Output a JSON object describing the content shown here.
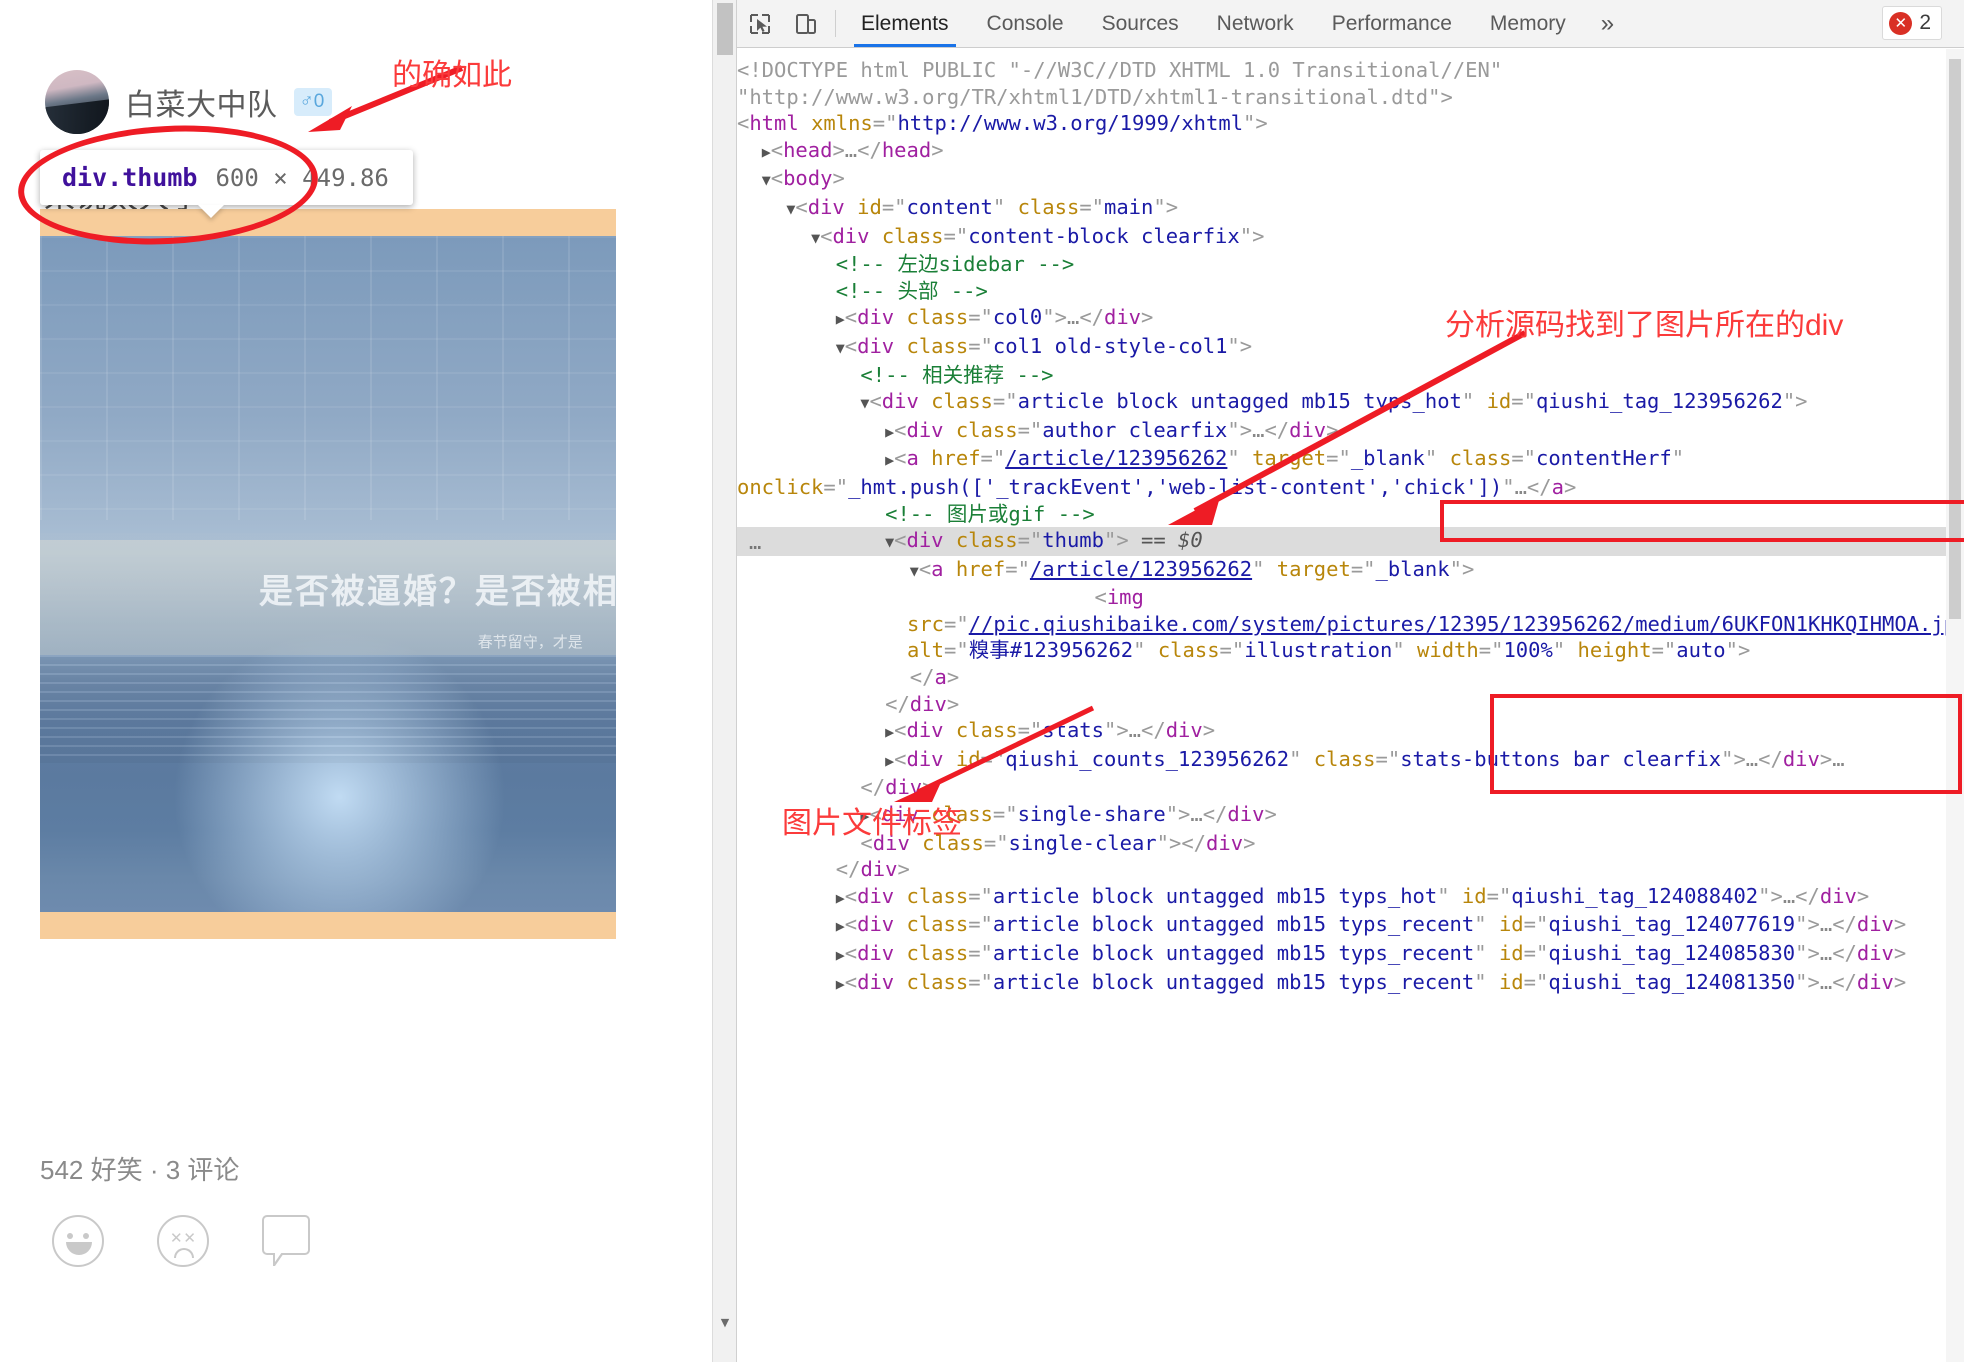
{
  "page": {
    "author_name": "白菜大中队",
    "gender_badge": "♂0",
    "text_behind_tooltip": "来说太大了",
    "banner_text": "是否被逼婚？是否被相亲",
    "banner_sub": "春节留守，才是",
    "stats": "542 好笑 · 3 评论",
    "reactions": [
      "smile-icon",
      "frown-icon",
      "comment-icon"
    ]
  },
  "tooltip": {
    "selector": "div.thumb",
    "dimensions": "600 × 449.86"
  },
  "annotations": [
    {
      "name": "confirm-note",
      "text": "的确如此"
    },
    {
      "name": "found-div-note",
      "text": "分析源码找到了图片所在的div"
    },
    {
      "name": "img-tag-note",
      "text": "图片文件标签"
    }
  ],
  "devtools": {
    "icons": [
      "inspect-element-icon",
      "device-toolbar-icon"
    ],
    "tabs": [
      {
        "label": "Elements",
        "active": true
      },
      {
        "label": "Console",
        "active": false
      },
      {
        "label": "Sources",
        "active": false
      },
      {
        "label": "Network",
        "active": false
      },
      {
        "label": "Performance",
        "active": false
      },
      {
        "label": "Memory",
        "active": false
      }
    ],
    "more_tabs": "»",
    "error_count": "2",
    "error_icon": "✕",
    "accent_color": "#1a73e8",
    "error_color": "#d93025",
    "dom_lines": [
      {
        "indent": 0,
        "type": "doctype",
        "text": "<!DOCTYPE html PUBLIC \"-//W3C//DTD XHTML 1.0 Transitional//EN\""
      },
      {
        "indent": 0,
        "type": "doctype",
        "text": "\"http://www.w3.org/TR/xhtml1/DTD/xhtml1-transitional.dtd\">"
      },
      {
        "indent": 0,
        "type": "open",
        "tag": "html",
        "attrs": [
          [
            "xmlns",
            "http://www.w3.org/1999/xhtml"
          ]
        ]
      },
      {
        "indent": 1,
        "type": "collapsed",
        "tw": "▶",
        "tag": "head"
      },
      {
        "indent": 1,
        "type": "open",
        "tw": "▼",
        "tag": "body"
      },
      {
        "indent": 2,
        "type": "open",
        "tw": "▼",
        "tag": "div",
        "attrs": [
          [
            "id",
            "content"
          ],
          [
            "class",
            "main"
          ]
        ]
      },
      {
        "indent": 3,
        "type": "open",
        "tw": "▼",
        "tag": "div",
        "attrs": [
          [
            "class",
            "content-block clearfix"
          ]
        ]
      },
      {
        "indent": 4,
        "type": "comment",
        "text": "<!-- 左边sidebar -->"
      },
      {
        "indent": 4,
        "type": "comment",
        "text": "<!-- 头部 -->"
      },
      {
        "indent": 4,
        "type": "collapsed",
        "tw": "▶",
        "tag": "div",
        "attrs": [
          [
            "class",
            "col0"
          ]
        ]
      },
      {
        "indent": 4,
        "type": "open",
        "tw": "▼",
        "tag": "div",
        "attrs": [
          [
            "class",
            "col1 old-style-col1"
          ]
        ]
      },
      {
        "indent": 5,
        "type": "comment",
        "text": "<!-- 相关推荐 -->"
      },
      {
        "indent": 5,
        "type": "open",
        "tw": "▼",
        "tag": "div",
        "attrs": [
          [
            "class",
            "article block untagged mb15 typs_hot"
          ],
          [
            "id",
            "qiushi_tag_123956262"
          ]
        ]
      },
      {
        "indent": 6,
        "type": "collapsed",
        "tw": "▶",
        "tag": "div",
        "attrs": [
          [
            "class",
            "author clearfix"
          ]
        ]
      },
      {
        "indent": 6,
        "type": "anchor-onclick",
        "tw": "▶",
        "tag": "a",
        "href": "/article/123956262",
        "target": "_blank",
        "class": "contentHerf",
        "onclick": "_hmt.push(['_trackEvent','web-list-content','chick'])"
      },
      {
        "indent": 6,
        "type": "comment",
        "text": "<!-- 图片或gif -->"
      },
      {
        "indent": 6,
        "type": "selected",
        "tw": "▼",
        "tag": "div",
        "attrs": [
          [
            "class",
            "thumb"
          ]
        ],
        "suffix": " == $0"
      },
      {
        "indent": 7,
        "type": "open",
        "tw": "▼",
        "tag": "a",
        "attrs": [
          [
            "href",
            "/article/123956262"
          ],
          [
            "target",
            "_blank"
          ]
        ],
        "link_attr": "href"
      },
      {
        "indent": 8,
        "type": "img",
        "src": "//pic.qiushibaike.com/system/pictures/12395/123956262/medium/6UKFON1KHKQIHMOA.jpg",
        "alt": "糗事#123956262",
        "class": "illustration",
        "width": "100%",
        "height": "auto"
      },
      {
        "indent": 7,
        "type": "close",
        "tag": "a"
      },
      {
        "indent": 6,
        "type": "close",
        "tag": "div"
      },
      {
        "indent": 6,
        "type": "collapsed",
        "tw": "▶",
        "tag": "div",
        "attrs": [
          [
            "class",
            "stats"
          ]
        ]
      },
      {
        "indent": 6,
        "type": "collapsed",
        "tw": "▶",
        "tag": "div",
        "attrs": [
          [
            "id",
            "qiushi_counts_123956262"
          ],
          [
            "class",
            "stats-buttons bar clearfix"
          ]
        ],
        "trail_dots": true
      },
      {
        "indent": 5,
        "type": "close",
        "tag": "div"
      },
      {
        "indent": 5,
        "type": "collapsed",
        "tw": "▶",
        "tag": "div",
        "attrs": [
          [
            "class",
            "single-share"
          ]
        ]
      },
      {
        "indent": 5,
        "type": "plain",
        "tag": "div",
        "attrs": [
          [
            "class",
            "single-clear"
          ]
        ],
        "empty": true
      },
      {
        "indent": 4,
        "type": "close",
        "tag": "div"
      },
      {
        "indent": 4,
        "type": "collapsed-wrap",
        "tw": "▶",
        "tag": "div",
        "attrs": [
          [
            "class",
            "article block untagged mb15 typs_hot"
          ],
          [
            "id",
            "qiushi_tag_124088402"
          ]
        ]
      },
      {
        "indent": 4,
        "type": "collapsed-wrap",
        "tw": "▶",
        "tag": "div",
        "attrs": [
          [
            "class",
            "article block untagged mb15 typs_recent"
          ],
          [
            "id",
            "qiushi_tag_124077619"
          ]
        ]
      },
      {
        "indent": 4,
        "type": "collapsed-wrap",
        "tw": "▶",
        "tag": "div",
        "attrs": [
          [
            "class",
            "article block untagged mb15 typs_recent"
          ],
          [
            "id",
            "qiushi_tag_124085830"
          ]
        ]
      },
      {
        "indent": 4,
        "type": "collapsed-wrap",
        "tw": "▶",
        "tag": "div",
        "attrs": [
          [
            "class",
            "article block untagged mb15 typs_recent"
          ],
          [
            "id",
            "qiushi_tag_124081350"
          ]
        ]
      }
    ]
  }
}
